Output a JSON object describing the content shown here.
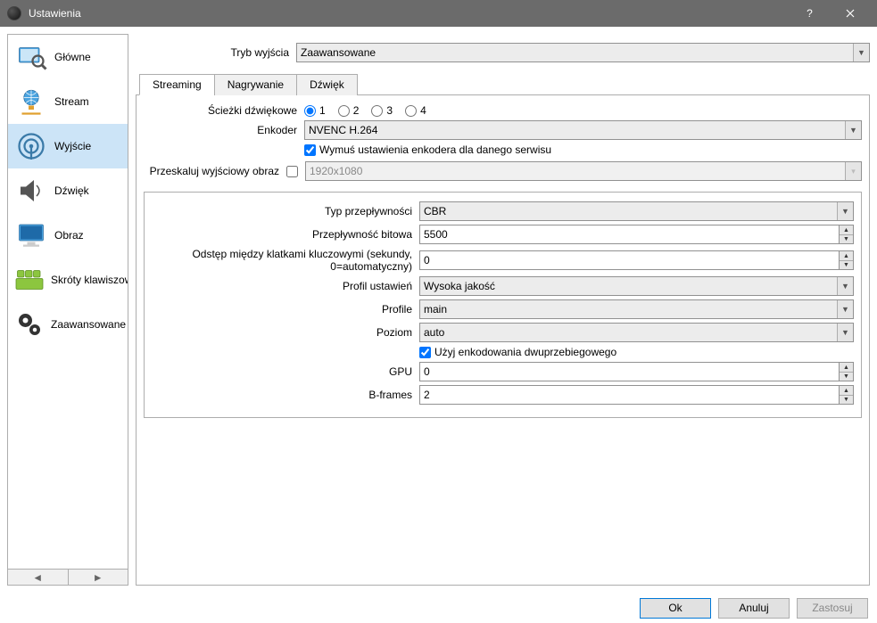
{
  "window": {
    "title": "Ustawienia"
  },
  "sidebar": {
    "items": [
      {
        "label": "Główne"
      },
      {
        "label": "Stream"
      },
      {
        "label": "Wyjście"
      },
      {
        "label": "Dźwięk"
      },
      {
        "label": "Obraz"
      },
      {
        "label": "Skróty klawiszowe"
      },
      {
        "label": "Zaawansowane"
      }
    ],
    "selected_index": 2
  },
  "output_mode": {
    "label": "Tryb wyjścia",
    "value": "Zaawansowane"
  },
  "tabs": [
    {
      "label": "Streaming"
    },
    {
      "label": "Nagrywanie"
    },
    {
      "label": "Dźwięk"
    }
  ],
  "active_tab": 0,
  "streaming": {
    "audio_tracks_label": "Ścieżki dźwiękowe",
    "audio_tracks": [
      "1",
      "2",
      "3",
      "4"
    ],
    "audio_track_selected": 0,
    "encoder_label": "Enkoder",
    "encoder_value": "NVENC H.264",
    "enforce_label": "Wymuś ustawienia enkodera dla danego serwisu",
    "enforce_checked": true,
    "rescale_label": "Przeskaluj wyjściowy obraz",
    "rescale_checked": false,
    "rescale_value": "1920x1080"
  },
  "encoder": {
    "rate_control_label": "Typ przepływności",
    "rate_control_value": "CBR",
    "bitrate_label": "Przepływność bitowa",
    "bitrate_value": "5500",
    "keyint_label": "Odstęp między klatkami kluczowymi (sekundy, 0=automatyczny)",
    "keyint_value": "0",
    "preset_label": "Profil ustawień",
    "preset_value": "Wysoka jakość",
    "profile_label": "Profile",
    "profile_value": "main",
    "level_label": "Poziom",
    "level_value": "auto",
    "twopass_label": "Użyj enkodowania dwuprzebiegowego",
    "twopass_checked": true,
    "gpu_label": "GPU",
    "gpu_value": "0",
    "bframes_label": "B-frames",
    "bframes_value": "2"
  },
  "buttons": {
    "ok": "Ok",
    "cancel": "Anuluj",
    "apply": "Zastosuj"
  }
}
